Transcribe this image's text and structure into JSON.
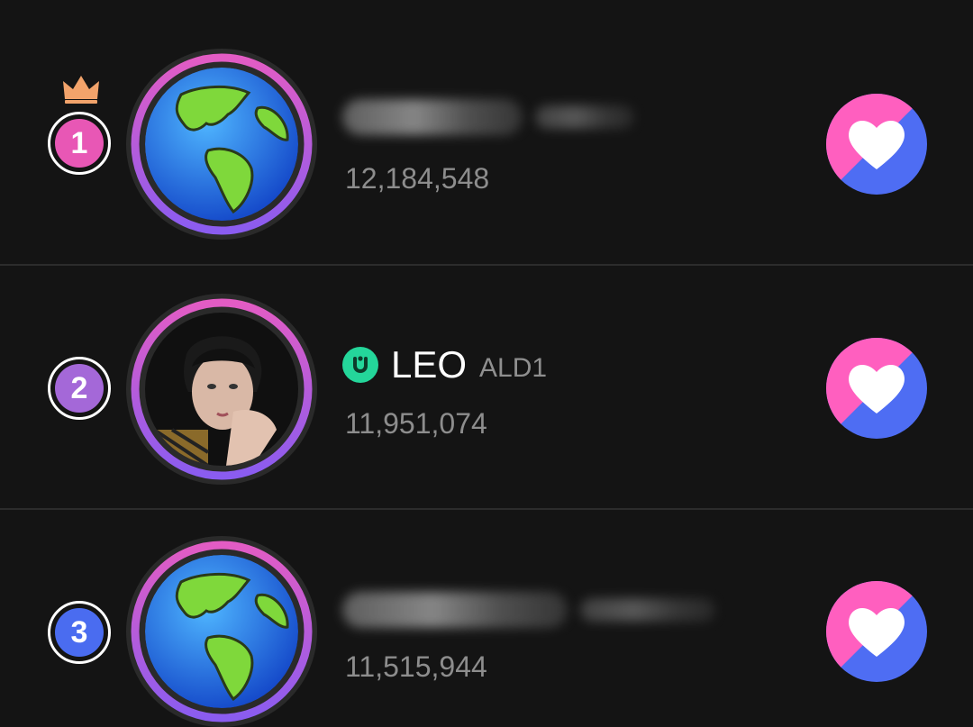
{
  "ranking": [
    {
      "rank": "1",
      "rank_color": "#e857b5",
      "has_crown": true,
      "name": "",
      "group": "",
      "name_blurred": true,
      "avatar": "globe-avatar",
      "votes": "12,184,548",
      "vote_icon": "heart-icon"
    },
    {
      "rank": "2",
      "rank_color": "#a468d8",
      "has_crown": false,
      "name": "LEO",
      "group": "ALD1",
      "name_blurred": false,
      "avatar": "idol-photo-avatar",
      "verified_icon": "verified-badge-icon",
      "votes": "11,951,074",
      "vote_icon": "heart-icon"
    },
    {
      "rank": "3",
      "rank_color": "#4a6cf0",
      "has_crown": false,
      "name": "",
      "group": "",
      "name_blurred": true,
      "avatar": "globe-avatar",
      "votes": "11,515,944",
      "vote_icon": "heart-icon"
    }
  ],
  "colors": {
    "background": "#141414",
    "ring_pink": "#e35cc4",
    "ring_purple": "#8a5cf0",
    "heart_pink": "#ff5fbf",
    "heart_blue": "#4e6df3",
    "crown": "#f2a36b"
  }
}
